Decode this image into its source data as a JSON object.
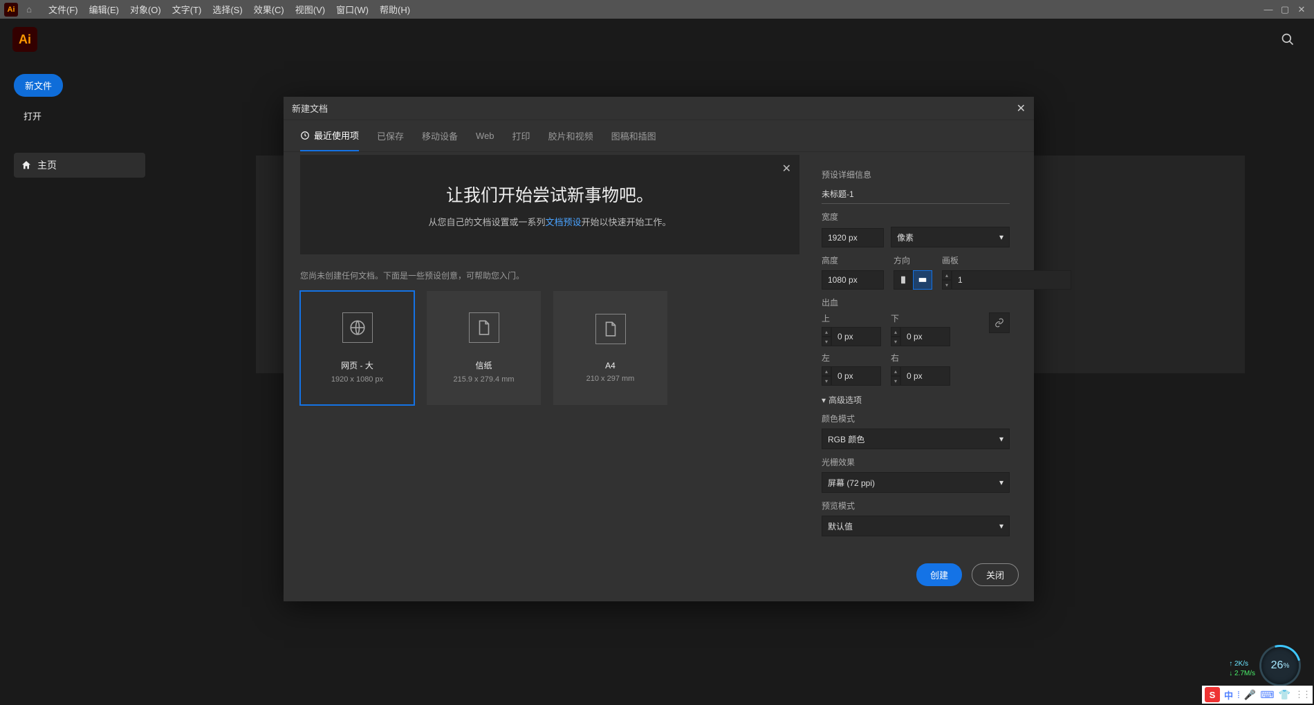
{
  "menubar": {
    "items": [
      "文件(F)",
      "编辑(E)",
      "对象(O)",
      "文字(T)",
      "选择(S)",
      "效果(C)",
      "视图(V)",
      "窗口(W)",
      "帮助(H)"
    ]
  },
  "sidebar": {
    "new_file": "新文件",
    "open": "打开",
    "home": "主页"
  },
  "dialog": {
    "title": "新建文档",
    "tabs": [
      "最近使用项",
      "已保存",
      "移动设备",
      "Web",
      "打印",
      "胶片和视频",
      "图稿和插图"
    ],
    "hero_title": "让我们开始尝试新事物吧。",
    "hero_sub_a": "从您自己的文档设置或一系列",
    "hero_link": "文档预设",
    "hero_sub_b": "开始以快速开始工作。",
    "sub_note": "您尚未创建任何文档。下面是一些预设创意，可帮助您入门。",
    "cards": [
      {
        "title": "网页 - 大",
        "dims": "1920 x 1080 px"
      },
      {
        "title": "信纸",
        "dims": "215.9 x 279.4 mm"
      },
      {
        "title": "A4",
        "dims": "210 x 297 mm"
      }
    ],
    "detail": {
      "heading": "预设详细信息",
      "name": "未标题-1",
      "width_label": "宽度",
      "width_value": "1920 px",
      "units": "像素",
      "height_label": "高度",
      "height_value": "1080 px",
      "orient_label": "方向",
      "artboard_label": "画板",
      "artboard_value": "1",
      "bleed_label": "出血",
      "top": "上",
      "bottom": "下",
      "left": "左",
      "right": "右",
      "bleed_val": "0 px",
      "adv": "高级选项",
      "color_mode_label": "颜色模式",
      "color_mode": "RGB 颜色",
      "raster_label": "光栅效果",
      "raster": "屏幕 (72 ppi)",
      "preview_label": "预览模式",
      "preview": "默认值"
    },
    "create": "创建",
    "close": "关闭"
  },
  "net": {
    "pct": "26",
    "up": "2K/s",
    "dn": "2.7M/s"
  },
  "tray": {
    "ime": "中"
  }
}
